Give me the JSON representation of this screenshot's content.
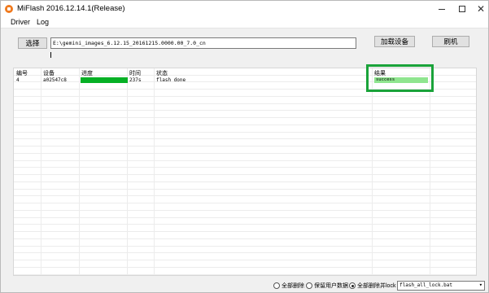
{
  "window": {
    "title": "MiFlash 2016.12.14.1(Release)"
  },
  "menu": {
    "items": [
      "Driver",
      "Log"
    ]
  },
  "toolbar": {
    "select_label": "选择",
    "path_value": "E:\\gemini_images_6.12.15_20161215.0000.00_7.0_cn",
    "load_device_label": "加载设备",
    "flash_label": "刷机"
  },
  "table": {
    "headers": [
      "编号",
      "设备",
      "进度",
      "时间",
      "状态",
      "结果"
    ],
    "rows": [
      {
        "id": "4",
        "device": "a02547c8",
        "progress": 1.0,
        "time": "237s",
        "status": "flash done",
        "result": "success"
      }
    ]
  },
  "bottom": {
    "options": [
      "全部删除",
      "保留用户数据",
      "全部删除并lock"
    ],
    "selected_option": "全部删除并lock",
    "script": "flash_all_lock.bat"
  },
  "colors": {
    "progress": "#06b025",
    "result_bg": "#8fe58f",
    "highlight": "#1aa33a"
  }
}
